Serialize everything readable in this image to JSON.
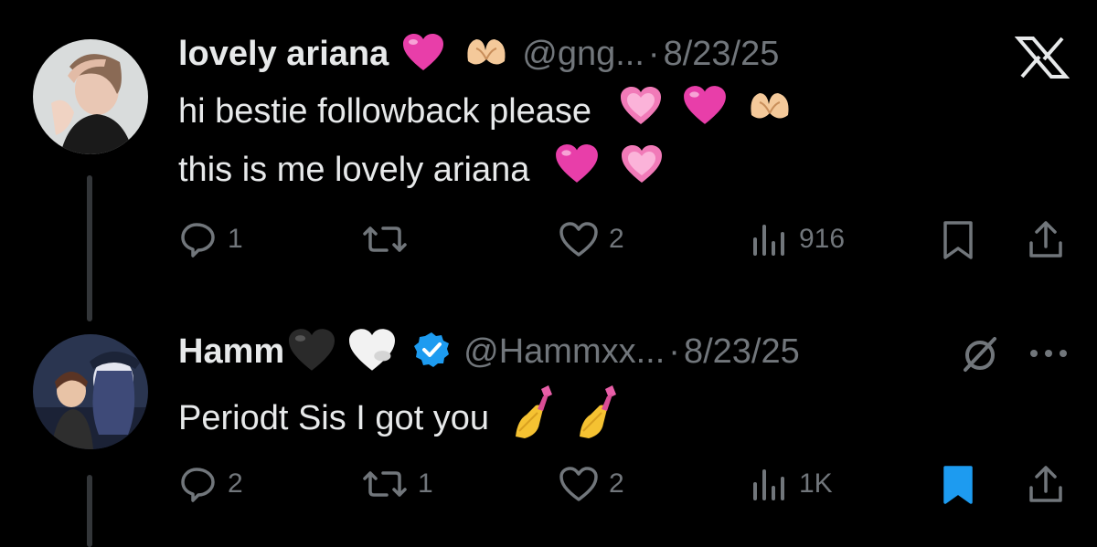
{
  "tweets": [
    {
      "name": "lovely ariana",
      "handle": "@gng...",
      "sep": "·",
      "date": "8/23/25",
      "line1": "hi bestie followback please",
      "line2": "this is me lovely ariana",
      "reply_count": "1",
      "retweet_count": "",
      "like_count": "2",
      "view_count": "916",
      "bookmarked": false
    },
    {
      "name": "Hamm",
      "handle": "@Hammxx...",
      "sep": "·",
      "date": "8/23/25",
      "line1": "Periodt Sis I got you",
      "reply_count": "2",
      "retweet_count": "1",
      "like_count": "2",
      "view_count": "1K",
      "bookmarked": true,
      "verified": true
    }
  ],
  "colors": {
    "background": "#000000",
    "text": "#e7e9ea",
    "muted": "#71767b",
    "accent": "#1d9bf0",
    "heart_pink": "#e83ea9",
    "sparkle_heart": "#f17ab8"
  },
  "icons": [
    "close-icon",
    "reply-icon",
    "retweet-icon",
    "like-icon",
    "views-icon",
    "bookmark-icon",
    "share-icon",
    "verified-badge-icon",
    "grok-icon",
    "more-icon",
    "pink-heart-icon",
    "heart-hands-icon",
    "sparkling-heart-icon",
    "black-heart-icon",
    "white-heart-icon",
    "nail-polish-icon"
  ]
}
